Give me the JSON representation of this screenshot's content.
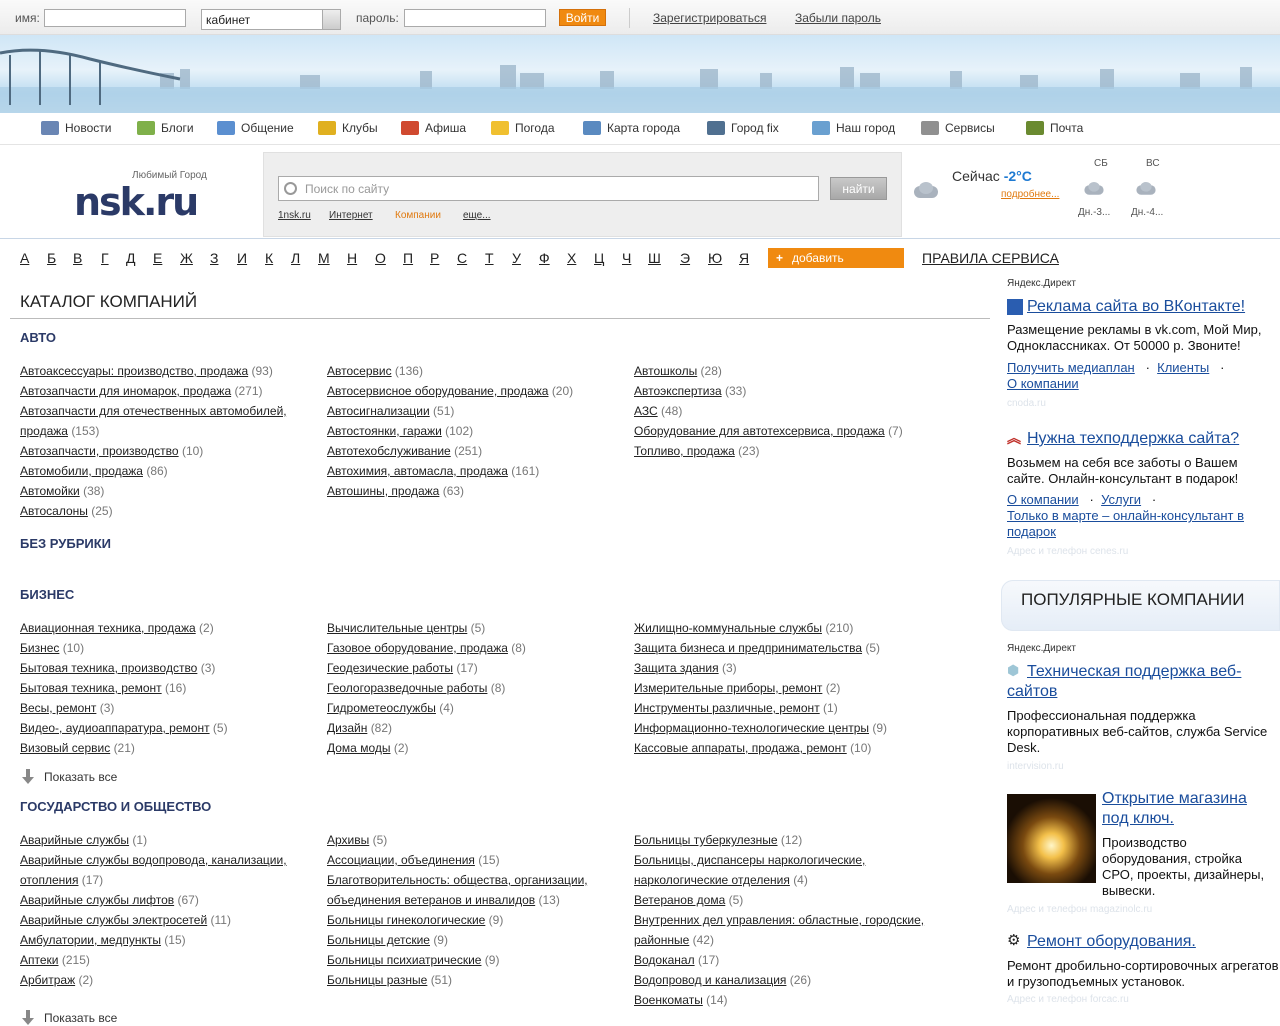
{
  "login": {
    "name_label": "имя:",
    "name_value": "",
    "cabinet_value": "кабинет",
    "password_label": "пароль:",
    "password_value": "",
    "submit": "Войти",
    "register": "Зарегистрироваться",
    "forgot": "Забыли пароль"
  },
  "nav": [
    {
      "label": "Новости",
      "icon": "newspaper-icon",
      "color": "#6a86b4"
    },
    {
      "label": "Блоги",
      "icon": "notepad-icon",
      "color": "#7fb04a"
    },
    {
      "label": "Общение",
      "icon": "people-icon",
      "color": "#5b8fd0"
    },
    {
      "label": "Клубы",
      "icon": "trophy-icon",
      "color": "#e0b020"
    },
    {
      "label": "Афиша",
      "icon": "megaphone-icon",
      "color": "#d04a30"
    },
    {
      "label": "Погода",
      "icon": "sun-cloud-icon",
      "color": "#f0c030"
    },
    {
      "label": "Карта города",
      "icon": "map-icon",
      "color": "#5a8ac0"
    },
    {
      "label": "Город fix",
      "icon": "tools-icon",
      "color": "#507090"
    },
    {
      "label": "Наш город",
      "icon": "city-icon",
      "color": "#6aa0d0"
    },
    {
      "label": "Сервисы",
      "icon": "service-bell-icon",
      "color": "#909090"
    },
    {
      "label": "Почта",
      "icon": "mail-book-icon",
      "color": "#6a8a30"
    }
  ],
  "logo": {
    "tagline": "Любимый Город",
    "name": "nsk.ru"
  },
  "search": {
    "placeholder": "Поиск по сайту",
    "button": "найти",
    "scopes": [
      "1nsk.ru",
      "Интернет",
      "Компании",
      "еще..."
    ]
  },
  "weather": {
    "now_label": "Сейчас",
    "now_temp": "-2°C",
    "more": "подробнее...",
    "days": [
      {
        "name": "СБ",
        "forecast": "Дн.-3..."
      },
      {
        "name": "ВС",
        "forecast": "Дн.-4..."
      }
    ]
  },
  "alphabet": [
    "А",
    "Б",
    "В",
    "Г",
    "Д",
    "Е",
    "Ж",
    "З",
    "И",
    "К",
    "Л",
    "М",
    "Н",
    "О",
    "П",
    "Р",
    "С",
    "Т",
    "У",
    "Ф",
    "Х",
    "Ц",
    "Ч",
    "Ш",
    "Э",
    "Ю",
    "Я"
  ],
  "add_button": "добавить",
  "rules": "ПРАВИЛА СЕРВИСА",
  "catalog": {
    "title": "КАТАЛОГ КОМПАНИЙ",
    "show_all": "Показать все",
    "sections": [
      {
        "title": "АВТО",
        "columns": [
          [
            {
              "name": "Автоаксессуары: производство, продажа",
              "count": "(93)"
            },
            {
              "name": "Автозапчасти для иномарок, продажа",
              "count": "(271)"
            },
            {
              "name": "Автозапчасти для отечественных автомобилей, продажа",
              "count": "(153)"
            },
            {
              "name": "Автозапчасти, производство",
              "count": "(10)"
            },
            {
              "name": "Автомобили, продажа",
              "count": "(86)"
            },
            {
              "name": "Автомойки",
              "count": "(38)"
            },
            {
              "name": "Автосалоны",
              "count": "(25)"
            }
          ],
          [
            {
              "name": "Автосервис",
              "count": "(136)"
            },
            {
              "name": "Автосервисное оборудование, продажа",
              "count": "(20)"
            },
            {
              "name": "Автосигнализации",
              "count": "(51)"
            },
            {
              "name": "Автостоянки, гаражи",
              "count": "(102)"
            },
            {
              "name": "Автотехобслуживание",
              "count": "(251)"
            },
            {
              "name": "Автохимия, автомасла, продажа",
              "count": "(161)"
            },
            {
              "name": "Автошины, продажа",
              "count": "(63)"
            }
          ],
          [
            {
              "name": "Автошколы",
              "count": "(28)"
            },
            {
              "name": "Автоэкспертиза",
              "count": "(33)"
            },
            {
              "name": "АЗС",
              "count": "(48)"
            },
            {
              "name": "Оборудование для автотехсервиса, продажа",
              "count": "(7)"
            },
            {
              "name": "Топливо, продажа",
              "count": "(23)"
            }
          ]
        ]
      },
      {
        "title": "БЕЗ РУБРИКИ",
        "columns": []
      },
      {
        "title": "БИЗНЕС",
        "columns": [
          [
            {
              "name": "Авиационная техника, продажа",
              "count": "(2)"
            },
            {
              "name": "Бизнес",
              "count": "(10)"
            },
            {
              "name": "Бытовая техника, производство",
              "count": "(3)"
            },
            {
              "name": "Бытовая техника, ремонт",
              "count": "(16)"
            },
            {
              "name": "Весы, ремонт",
              "count": "(3)"
            },
            {
              "name": "Видео-, аудиоаппаратура, ремонт",
              "count": "(5)"
            },
            {
              "name": "Визовый сервис",
              "count": "(21)"
            }
          ],
          [
            {
              "name": "Вычислительные центры",
              "count": "(5)"
            },
            {
              "name": "Газовое оборудование, продажа",
              "count": "(8)"
            },
            {
              "name": "Геодезические работы",
              "count": "(17)"
            },
            {
              "name": "Геологоразведочные работы",
              "count": "(8)"
            },
            {
              "name": "Гидрометеослужбы",
              "count": "(4)"
            },
            {
              "name": "Дизайн",
              "count": "(82)"
            },
            {
              "name": "Дома моды",
              "count": "(2)"
            }
          ],
          [
            {
              "name": "Жилищно-коммунальные службы",
              "count": "(210)"
            },
            {
              "name": "Защита бизнеса и предпринимательства",
              "count": "(5)"
            },
            {
              "name": "Защита здания",
              "count": "(3)"
            },
            {
              "name": "Измерительные приборы, ремонт",
              "count": "(2)"
            },
            {
              "name": "Инструменты различные, ремонт",
              "count": "(1)"
            },
            {
              "name": "Информационно-технологические центры",
              "count": "(9)"
            },
            {
              "name": "Кассовые аппараты, продажа, ремонт",
              "count": "(10)"
            }
          ]
        ]
      },
      {
        "title": "ГОСУДАРСТВО И ОБЩЕСТВО",
        "columns": [
          [
            {
              "name": "Аварийные службы",
              "count": "(1)"
            },
            {
              "name": "Аварийные службы водопровода, канализации, отопления",
              "count": "(17)"
            },
            {
              "name": "Аварийные службы лифтов",
              "count": "(67)"
            },
            {
              "name": "Аварийные службы электросетей",
              "count": "(11)"
            },
            {
              "name": "Амбулатории, медпункты",
              "count": "(15)"
            },
            {
              "name": "Аптеки",
              "count": "(215)"
            },
            {
              "name": "Арбитраж",
              "count": "(2)"
            }
          ],
          [
            {
              "name": "Архивы",
              "count": "(5)"
            },
            {
              "name": "Ассоциации, объединения",
              "count": "(15)"
            },
            {
              "name": "Благотворительность: общества, организации, объединения ветеранов и инвалидов",
              "count": "(13)"
            },
            {
              "name": "Больницы гинекологические",
              "count": "(9)"
            },
            {
              "name": "Больницы детские",
              "count": "(9)"
            },
            {
              "name": "Больницы психиатрические",
              "count": "(9)"
            },
            {
              "name": "Больницы разные",
              "count": "(51)"
            }
          ],
          [
            {
              "name": "Больницы туберкулезные",
              "count": "(12)"
            },
            {
              "name": "Больницы, диспансеры наркологические, наркологические отделения",
              "count": "(4)"
            },
            {
              "name": "Ветеранов дома",
              "count": "(5)"
            },
            {
              "name": "Внутренних дел управления: областные, городские, районные",
              "count": "(42)"
            },
            {
              "name": "Водоканал",
              "count": "(17)"
            },
            {
              "name": "Водопровод и канализация",
              "count": "(26)"
            },
            {
              "name": "Военкоматы",
              "count": "(14)"
            }
          ]
        ]
      }
    ]
  },
  "ads": {
    "direct_label": "Яндекс.Директ",
    "top": [
      {
        "title": "Реклама сайта во ВКонтакте!",
        "text": "Размещение рекламы в vk.com, Мой Мир, Одноклассниках. От 50000 р. Звоните!",
        "links": [
          "Получить медиаплан",
          "Клиенты",
          "О компании"
        ],
        "domain": "cnoda.ru"
      },
      {
        "title": "Нужна техподдержка сайта?",
        "text": "Возьмем на себя все заботы о Вашем сайте. Онлайн-консультант в подарок!",
        "links": [
          "О компании",
          "Услуги",
          "Только в марте – онлайн-консультант в подарок"
        ],
        "domain": "Адрес и телефон  cenes.ru"
      }
    ],
    "popular_title": "ПОПУЛЯРНЫЕ КОМПАНИИ",
    "bottom": [
      {
        "title": "Техническая поддержка веб-сайтов",
        "text": "Профессиональная поддержка корпоративных веб-сайтов, служба Service Desk.",
        "domain": "intervision.ru"
      },
      {
        "title": "Открытие магазина под ключ.",
        "text": "Производство оборудования, стройка СРО, проекты, дизайнеры, вывески.",
        "domain": "Адрес и телефон  magazinolc.ru"
      },
      {
        "title": "Ремонт оборудования.",
        "text": "Ремонт дробильно-сортировочных агрегатов и грузоподъемных установок.",
        "domain": "Адрес и телефон  forcac.ru"
      }
    ]
  }
}
